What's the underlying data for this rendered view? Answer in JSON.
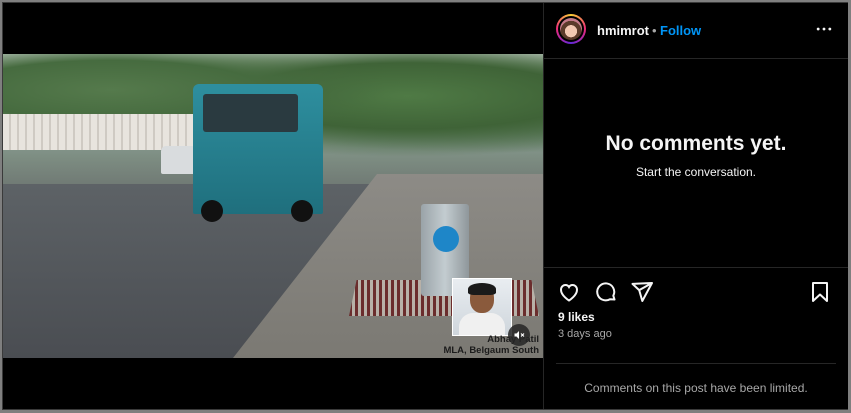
{
  "post": {
    "username": "hmimrot",
    "separator": "•",
    "follow_label": "Follow",
    "more_icon": "more-horizontal-icon"
  },
  "video": {
    "caption_line1": "Abhay Patil",
    "caption_line2": "MLA, Belgaum South",
    "muted": true
  },
  "comments": {
    "empty_title": "No comments yet.",
    "empty_subtitle": "Start the conversation.",
    "limited_notice": "Comments on this post have been limited."
  },
  "engagement": {
    "likes": "9 likes",
    "posted": "3 days ago",
    "icons": [
      "heart-icon",
      "comment-icon",
      "share-icon",
      "save-icon"
    ]
  },
  "colors": {
    "accent": "#0095f6",
    "background": "#000000",
    "muted_text": "#a8a8a8",
    "divider": "#262626"
  }
}
